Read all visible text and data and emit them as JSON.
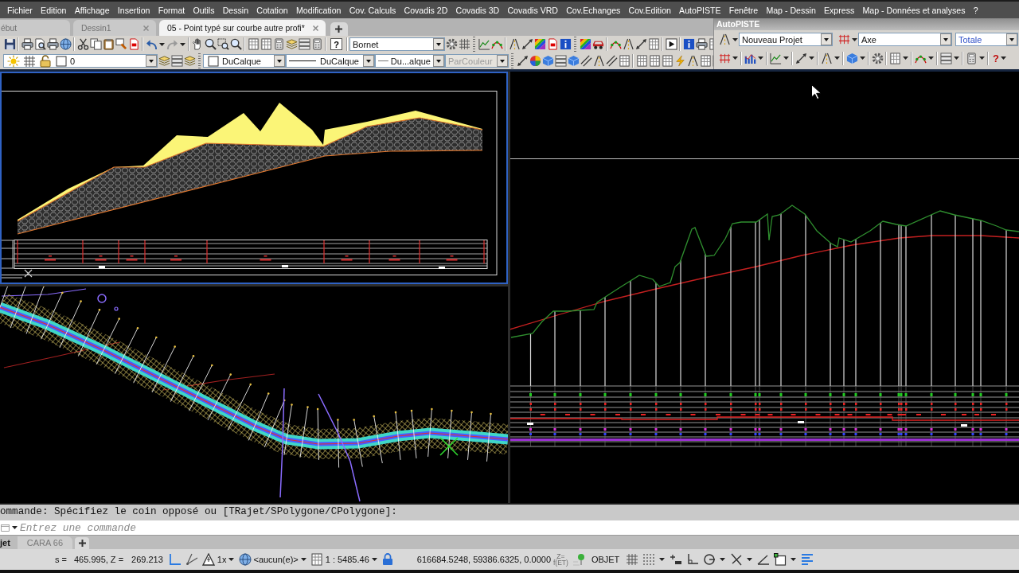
{
  "menu_bar": {
    "items": [
      "Fichier",
      "Edition",
      "Affichage",
      "Insertion",
      "Format",
      "Outils",
      "Dessin",
      "Cotation",
      "Modification",
      "Cov. Calculs",
      "Covadis 2D",
      "Covadis 3D",
      "Covadis VRD",
      "Cov.Echanges",
      "Cov.Edition",
      "AutoPISTE",
      "Fenêtre",
      "Map - Dessin",
      "Express",
      "Map - Données et analyses",
      "?"
    ]
  },
  "document_tabs": {
    "tabs": [
      {
        "label": "ébut",
        "selected": false,
        "closable": false
      },
      {
        "label": "Dessin1",
        "selected": false,
        "closable": true
      },
      {
        "label": "05 - Point typé sur courbe autre profi*",
        "selected": true,
        "closable": true
      }
    ]
  },
  "standard_toolbar": {
    "help_symbol": "?",
    "text_style": {
      "value": "Bornet"
    }
  },
  "properties_toolbar": {
    "layer": {
      "value": "0"
    },
    "color": {
      "value": "DuCalque"
    },
    "linetype": {
      "value": "DuCalque"
    },
    "lineweight": {
      "value": "Du...alque"
    },
    "plot_style": {
      "value": "ParCouleur",
      "disabled": true
    }
  },
  "autopiste_panel": {
    "title": "AutoPISTE",
    "project": {
      "value": "Nouveau Projet"
    },
    "axis": {
      "value": "Axe"
    },
    "scope": {
      "value": "Totale"
    },
    "help_symbol": "?"
  },
  "viewports": [
    {
      "kind": "layer_profile",
      "selected": true
    },
    {
      "kind": "plan",
      "selected": false
    },
    {
      "kind": "long_profile",
      "selected": false
    }
  ],
  "command_line": {
    "history": "ommande: Spécifiez le coin opposé ou [TRajet/SPolygone/CPolygone]:",
    "input": {
      "placeholder": "Entrez une commande"
    }
  },
  "layout_tabs": {
    "tabs": [
      {
        "label": "jet",
        "selected": true
      },
      {
        "label": "CARA 66",
        "selected": false
      }
    ]
  },
  "status_bar": {
    "station_label": "s =",
    "station_value": "465.995, Z =",
    "elevation_value": "269.213",
    "annotation_scale": "1x",
    "coordinate_system": "<aucun(e)>",
    "viewport_scale": "1 : 5485.46",
    "coordinates": "616684.5248, 59386.6325, 0.0000",
    "z_function": {
      "lines": [
        "Z=",
        "f(ET)"
      ],
      "disabled": true
    },
    "snap_mode": "OBJET"
  }
}
